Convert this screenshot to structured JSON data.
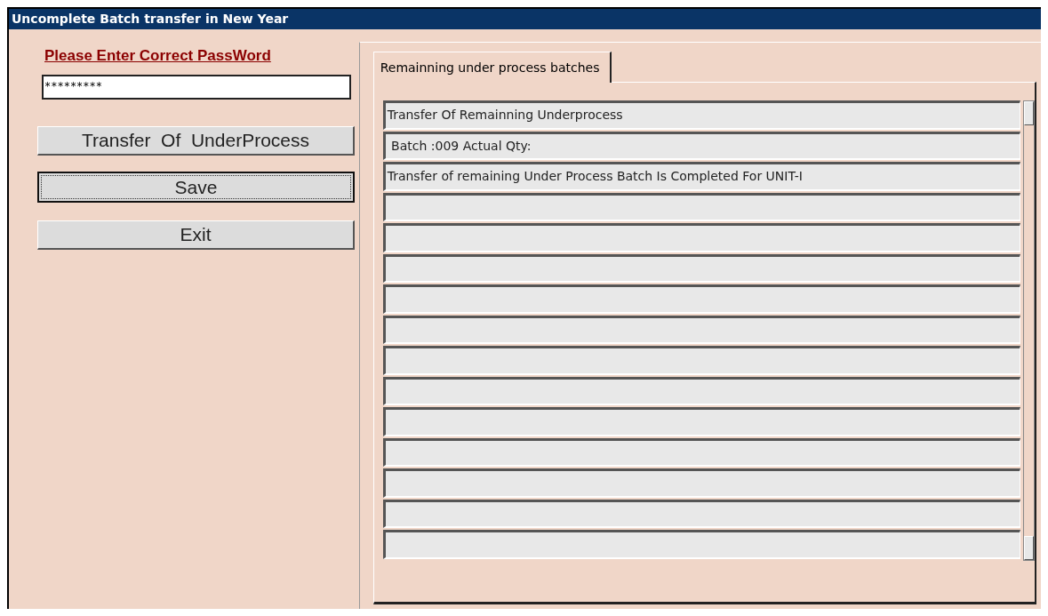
{
  "window": {
    "title": "Uncomplete Batch transfer in New Year"
  },
  "password": {
    "label": "Please Enter Correct PassWord",
    "value": "*********"
  },
  "buttons": [
    {
      "label": "Transfer  Of  UnderProcess",
      "focused": false
    },
    {
      "label": "Save",
      "focused": true
    },
    {
      "label": "Exit",
      "focused": false
    }
  ],
  "tabs": [
    {
      "label": "Remainning under process batches",
      "selected": true
    }
  ],
  "rows": [
    {
      "kind": "text",
      "text": "Transfer Of Remainning Underprocess"
    },
    {
      "kind": "text",
      "text": " Batch :009 Actual Qty:"
    },
    {
      "kind": "text",
      "text": "Transfer of remaining Under Process Batch Is Completed For UNIT-I"
    },
    {
      "kind": "empty"
    },
    {
      "kind": "empty"
    },
    {
      "kind": "empty"
    },
    {
      "kind": "empty"
    },
    {
      "kind": "empty"
    },
    {
      "kind": "empty"
    },
    {
      "kind": "empty"
    },
    {
      "kind": "empty"
    },
    {
      "kind": "empty"
    },
    {
      "kind": "empty"
    },
    {
      "kind": "empty"
    },
    {
      "kind": "empty"
    }
  ]
}
